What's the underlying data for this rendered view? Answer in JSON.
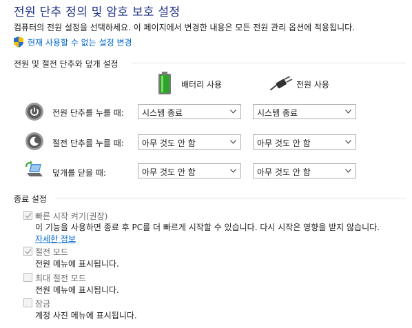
{
  "header": {
    "title": "전원 단추 정의 및 암호 보호 설정",
    "intro": "컴퓨터의 전원 설정을 선택하세요. 이 페이지에서 변경한 내용은 모든 전원 관리 옵션에 적용됩니다.",
    "change_link": "현재 사용할 수 없는 설정 변경"
  },
  "power_section": {
    "heading": "전원 및 절전 단추와 덮개 설정",
    "col_battery": "배터리 사용",
    "col_plugged": "전원 사용",
    "rows": [
      {
        "label": "전원 단추를 누를 때:",
        "battery": "시스템 종료",
        "plugged": "시스템 종료"
      },
      {
        "label": "절전 단추를 누를 때:",
        "battery": "아무 것도 안 함",
        "plugged": "아무 것도 안 함"
      },
      {
        "label": "덮개를 닫을 때:",
        "battery": "아무 것도 안 함",
        "plugged": "아무 것도 안 함"
      }
    ]
  },
  "shutdown_section": {
    "heading": "종료 설정",
    "options": [
      {
        "label": "빠른 시작 켜기(권장)",
        "desc": "이 기능을 사용하면 종료 후 PC를 더 빠르게 시작할 수 있습니다. 다시 시작은 영향을 받지 않습니다.",
        "link": "자세한 정보",
        "checked": true
      },
      {
        "label": "절전 모드",
        "desc": "전원 메뉴에 표시됩니다.",
        "checked": true
      },
      {
        "label": "최대 절전 모드",
        "desc": "전원 메뉴에 표시됩니다.",
        "checked": false
      },
      {
        "label": "잠금",
        "desc": "계정 사진 메뉴에 표시됩니다.",
        "checked": false
      }
    ]
  },
  "colors": {
    "title": "#1e3287",
    "link": "#0066cc",
    "disabled_text": "#6d6d6d"
  }
}
